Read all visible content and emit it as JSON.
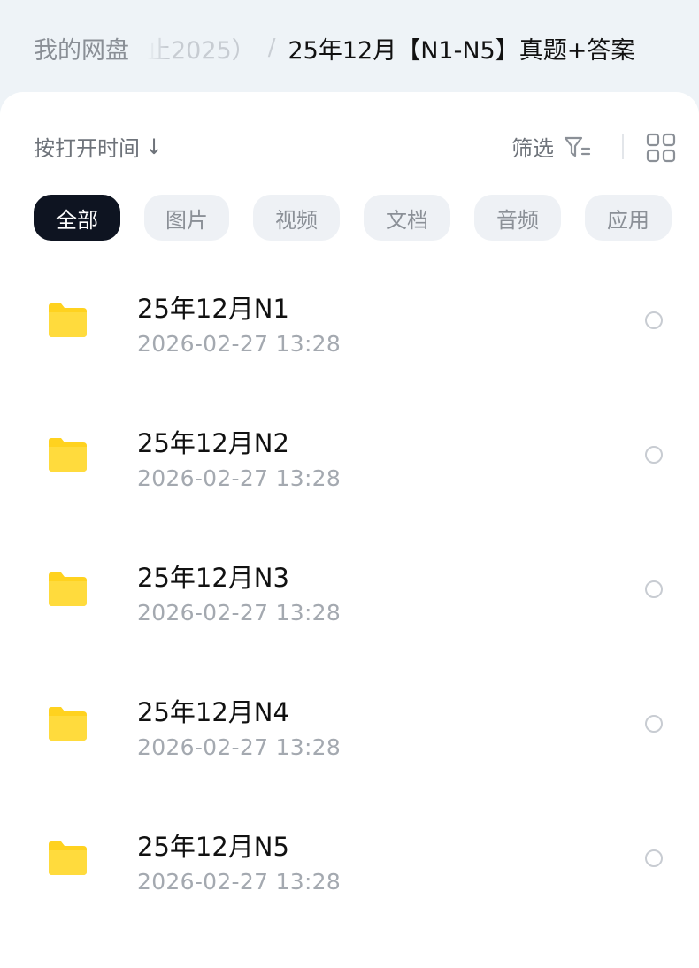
{
  "breadcrumb": {
    "root": "我的网盘",
    "middle": "止2025）",
    "separator": "/",
    "current": "25年12月【N1-N5】真题+答案"
  },
  "toolbar": {
    "sort_label": "按打开时间",
    "sort_arrow": "↓",
    "filter_label": "筛选"
  },
  "icons": {
    "filter": "filter-icon",
    "grid_view": "grid-view-icon",
    "folder": "folder-icon",
    "select": "radio-circle"
  },
  "colors": {
    "folder": "#ffd21f",
    "active_chip": "#0e1421"
  },
  "categories": [
    {
      "label": "全部",
      "active": true
    },
    {
      "label": "图片",
      "active": false
    },
    {
      "label": "视频",
      "active": false
    },
    {
      "label": "文档",
      "active": false
    },
    {
      "label": "音频",
      "active": false
    },
    {
      "label": "应用",
      "active": false
    }
  ],
  "files": [
    {
      "name": "25年12月N1",
      "date": "2026-02-27  13:28"
    },
    {
      "name": "25年12月N2",
      "date": "2026-02-27  13:28"
    },
    {
      "name": "25年12月N3",
      "date": "2026-02-27  13:28"
    },
    {
      "name": "25年12月N4",
      "date": "2026-02-27  13:28"
    },
    {
      "name": "25年12月N5",
      "date": "2026-02-27  13:28"
    }
  ]
}
